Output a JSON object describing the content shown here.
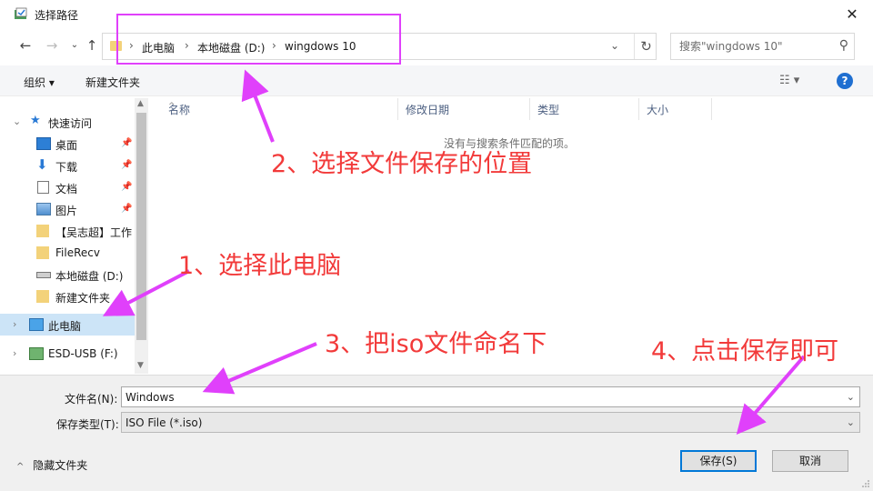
{
  "window": {
    "title": "选择路径",
    "close_glyph": "✕"
  },
  "navigation": {
    "back_icon": "arrow-left-icon",
    "forward_icon": "arrow-right-icon",
    "recent_icon": "chevron-down-icon",
    "up_icon": "arrow-up-icon",
    "breadcrumb": [
      "此电脑",
      "本地磁盘 (D:)",
      "wingdows 10"
    ],
    "search_placeholder": "搜索\"wingdows 10\""
  },
  "toolbar": {
    "organize": "组织 ▾",
    "new_folder": "新建文件夹"
  },
  "sidebar": {
    "quick_access": "快速访问",
    "items": [
      {
        "label": "桌面",
        "icon": "desktop-icon",
        "pinned": true
      },
      {
        "label": "下载",
        "icon": "download-icon",
        "pinned": true
      },
      {
        "label": "文档",
        "icon": "document-icon",
        "pinned": true
      },
      {
        "label": "图片",
        "icon": "pictures-icon",
        "pinned": true
      },
      {
        "label": "【吴志超】工作",
        "icon": "folder-icon",
        "pinned": false
      },
      {
        "label": "FileRecv",
        "icon": "folder-icon",
        "pinned": false
      },
      {
        "label": "本地磁盘 (D:)",
        "icon": "drive-icon",
        "pinned": false
      },
      {
        "label": "新建文件夹",
        "icon": "folder-icon",
        "pinned": false
      }
    ],
    "this_pc": "此电脑",
    "usb": "ESD-USB (F:)"
  },
  "columns": [
    "名称",
    "修改日期",
    "类型",
    "大小"
  ],
  "empty_message": "没有与搜索条件匹配的项。",
  "form": {
    "filename_label": "文件名(N):",
    "filename_value": "Windows",
    "filetype_label": "保存类型(T):",
    "filetype_value": "ISO File (*.iso)",
    "hide_folders": "隐藏文件夹",
    "save": "保存(S)",
    "cancel": "取消"
  },
  "annotations": {
    "step1": "1、选择此电脑",
    "step2": "2、选择文件保存的位置",
    "step3": "3、把iso文件命名下",
    "step4": "4、点击保存即可",
    "color": "#f23a3a",
    "arrow_color": "#e040fb"
  },
  "colors": {
    "accent": "#0078d7",
    "selection": "#cce4f7",
    "highlight_box": "#e040fb"
  }
}
